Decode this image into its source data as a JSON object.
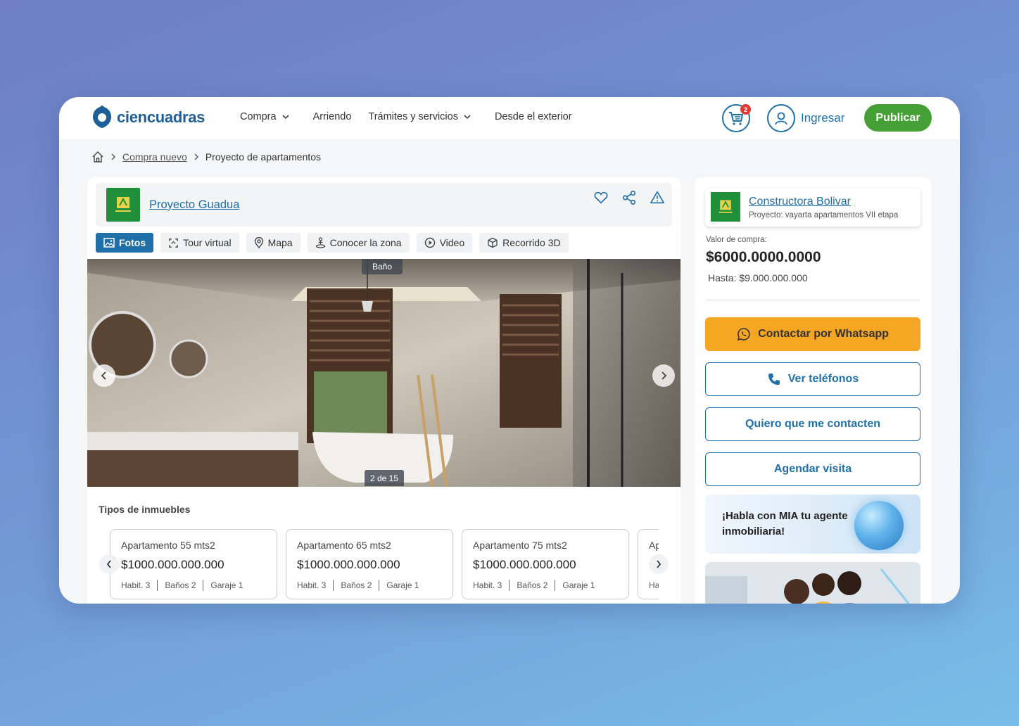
{
  "header": {
    "brand": "ciencuadras",
    "nav": [
      "Compra",
      "Arriendo",
      "Trámites y servicios",
      "Desde el exterior"
    ],
    "cart_count": "2",
    "login_label": "Ingresar",
    "publish_label": "Publicar"
  },
  "breadcrumb": {
    "section": "Compra nuevo",
    "current": "Proyecto de apartamentos"
  },
  "project": {
    "name": "Proyecto Guadua",
    "tabs": [
      "Fotos",
      "Tour virtual",
      "Mapa",
      "Conocer la zona",
      "Video",
      "Recorrido 3D"
    ],
    "photo_tag": "Baño",
    "photo_counter": "2 de 15"
  },
  "types": {
    "title": "Tipos de inmuebles",
    "cards": [
      {
        "name": "Apartamento 55 mts2",
        "price": "$1000.000.000.000",
        "rooms": "Habit. 3",
        "baths": "Baños 2",
        "garage": "Garaje 1"
      },
      {
        "name": "Apartamento 65 mts2",
        "price": "$1000.000.000.000",
        "rooms": "Habit. 3",
        "baths": "Baños 2",
        "garage": "Garaje 1"
      },
      {
        "name": "Apartamento 75 mts2",
        "price": "$1000.000.000.000",
        "rooms": "Habit. 3",
        "baths": "Baños 2",
        "garage": "Garaje 1"
      },
      {
        "name": "Ap",
        "price": "",
        "rooms": "Ha",
        "baths": "",
        "garage": ""
      }
    ]
  },
  "builder": {
    "name": "Constructora Bolivar",
    "project_line": "Proyecto: vayarta apartamentos VII etapa",
    "price_label": "Valor de compra:",
    "price": "$6000.0000.0000",
    "price_to": "Hasta: $9.000.000.000"
  },
  "actions": {
    "whatsapp": "Contactar por Whatsapp",
    "phones": "Ver teléfonos",
    "contact": "Quiero que me contacten",
    "visit": "Agendar visita"
  },
  "mia": {
    "text": "¡Habla con MIA tu agente inmobiliaria!"
  },
  "colors": {
    "brand_blue": "#1f6fa8",
    "publish_green": "#44a035",
    "whatsapp_orange": "#f5a623"
  }
}
